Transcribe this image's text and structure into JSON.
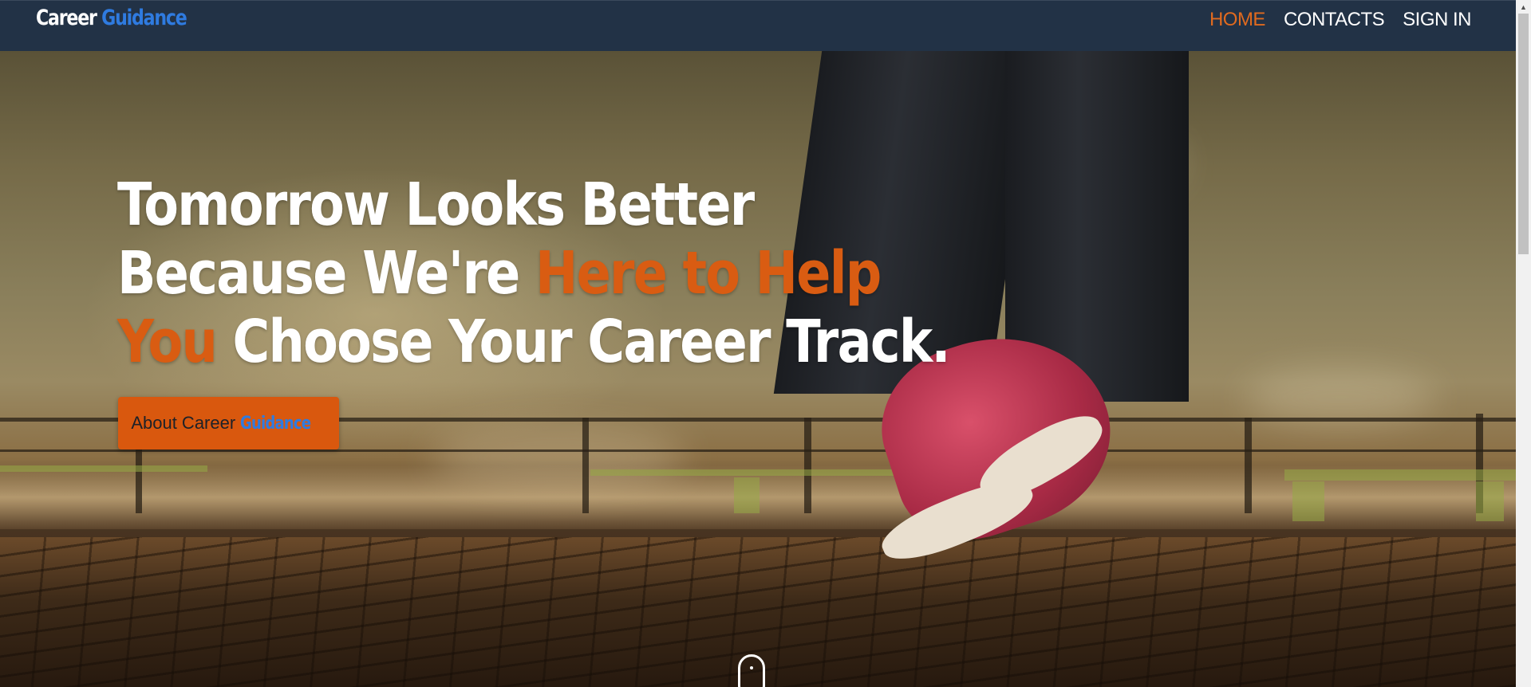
{
  "brand": {
    "name_part1": "Career",
    "name_part2": "Guidance"
  },
  "nav": {
    "items": [
      {
        "label": "HOME",
        "active": true
      },
      {
        "label": "CONTACTS",
        "active": false
      },
      {
        "label": "SIGN IN",
        "active": false
      }
    ]
  },
  "hero": {
    "title_line1": "Tomorrow Looks Better",
    "title_line2_a": "Because We're ",
    "title_line2_b": "Here to Help",
    "title_line3_a": "You",
    "title_line3_b": " Choose Your Career Track.",
    "button_label_a": "About Career",
    "button_label_b": "Guidance",
    "scroll_icon": "mouse-scroll-icon"
  },
  "colors": {
    "navbar": "#223246",
    "accent_orange": "#d95c12",
    "accent_blue": "#2f7be0",
    "text": "#ffffff"
  }
}
